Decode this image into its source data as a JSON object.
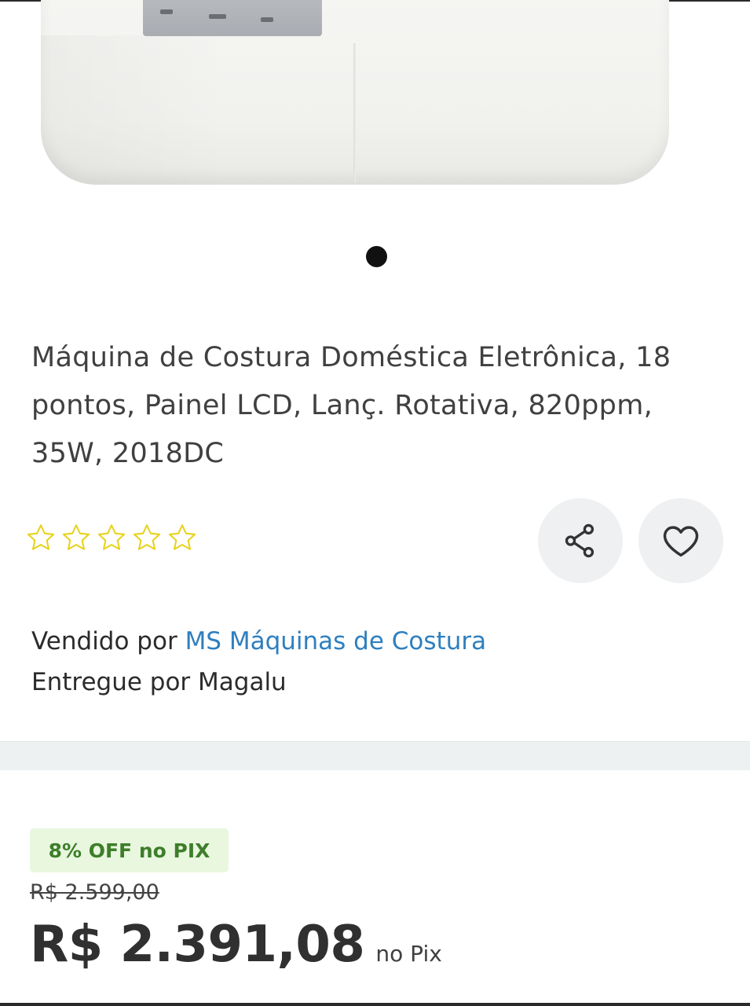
{
  "product": {
    "title": "Máquina de Costura Doméstica Eletrônica, 18 pontos, Painel LCD, Lanç. Rotativa, 820ppm, 35W, 2018DC",
    "rating_stars": 0,
    "rating_max": 5,
    "star_color": "#e8d21a"
  },
  "seller": {
    "sold_by_prefix": "Vendido por",
    "sold_by_name": "MS Máquinas de Costura",
    "delivered_by": "Entregue por Magalu",
    "link_color": "#2e7fbf"
  },
  "price": {
    "discount_badge": "8% OFF no PIX",
    "old_price": "R$ 2.599,00",
    "current_price": "R$ 2.391,08",
    "price_suffix": "no Pix"
  },
  "actions": {
    "share_icon": "share-icon",
    "favorite_icon": "heart-icon"
  }
}
